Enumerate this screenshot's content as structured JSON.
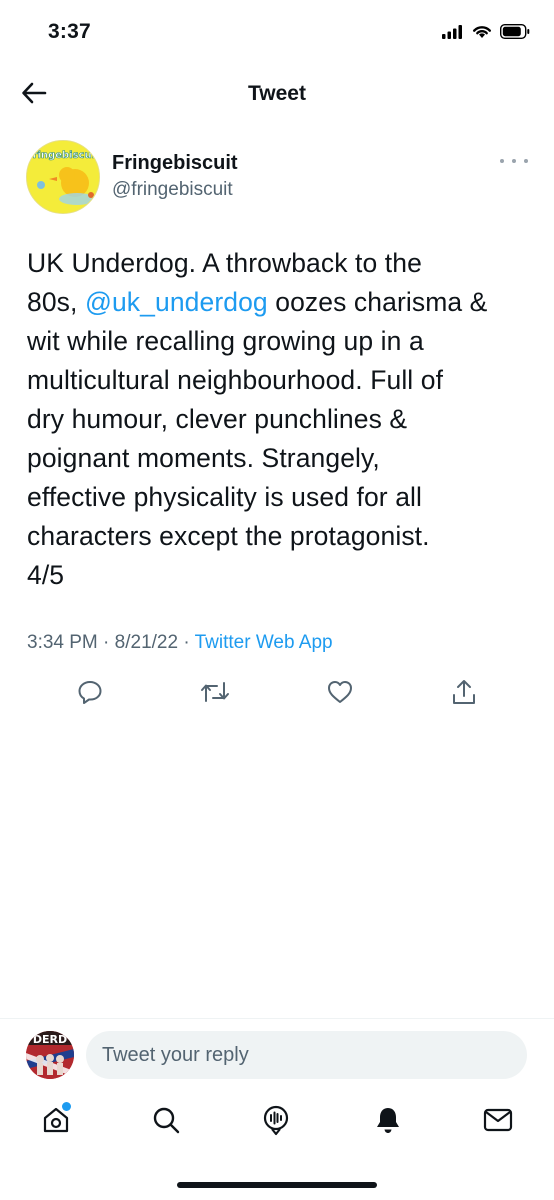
{
  "status_bar": {
    "time": "3:37"
  },
  "header": {
    "title": "Tweet"
  },
  "author": {
    "name": "Fringebiscuit",
    "handle": "@fringebiscuit",
    "avatar_text": "fringebiscuit"
  },
  "tweet": {
    "lines": [
      {
        "before": "UK Underdog. A throwback to the",
        "mention": "",
        "after": ""
      },
      {
        "before": "80s, ",
        "mention": "@uk_underdog",
        "after": " oozes charisma &"
      },
      {
        "before": "wit while recalling growing up in a",
        "mention": "",
        "after": ""
      },
      {
        "before": "multicultural neighbourhood. Full of",
        "mention": "",
        "after": ""
      },
      {
        "before": "dry humour, clever punchlines &",
        "mention": "",
        "after": ""
      },
      {
        "before": "poignant moments. Strangely,",
        "mention": "",
        "after": ""
      },
      {
        "before": "effective physicality is used for all",
        "mention": "",
        "after": ""
      },
      {
        "before": "characters except the protagonist.",
        "mention": "",
        "after": ""
      },
      {
        "before": "4/5",
        "mention": "",
        "after": ""
      }
    ]
  },
  "meta": {
    "time": "3:34 PM",
    "separator": " · ",
    "date": "8/21/22",
    "source": "Twitter Web App"
  },
  "actions": [
    "reply-icon",
    "retweet-icon",
    "like-icon",
    "share-icon"
  ],
  "reply": {
    "placeholder": "Tweet your reply",
    "avatar_text": "DERD"
  },
  "bottom_nav": [
    "home-icon",
    "search-icon",
    "spaces-icon",
    "notifications-icon",
    "messages-icon"
  ],
  "colors": {
    "accent": "#1d9bf0",
    "text": "#0f1419",
    "secondary": "#536471",
    "avatar_yellow": "#f2ea3c"
  }
}
